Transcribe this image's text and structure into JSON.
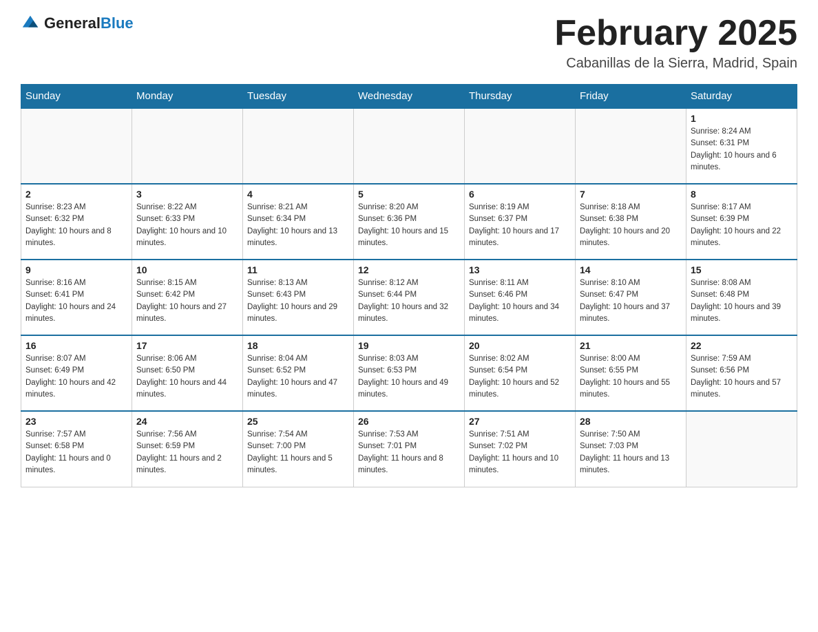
{
  "header": {
    "logo_general": "General",
    "logo_blue": "Blue",
    "month_title": "February 2025",
    "location": "Cabanillas de la Sierra, Madrid, Spain"
  },
  "days_of_week": [
    "Sunday",
    "Monday",
    "Tuesday",
    "Wednesday",
    "Thursday",
    "Friday",
    "Saturday"
  ],
  "weeks": [
    [
      {
        "day": "",
        "info": ""
      },
      {
        "day": "",
        "info": ""
      },
      {
        "day": "",
        "info": ""
      },
      {
        "day": "",
        "info": ""
      },
      {
        "day": "",
        "info": ""
      },
      {
        "day": "",
        "info": ""
      },
      {
        "day": "1",
        "info": "Sunrise: 8:24 AM\nSunset: 6:31 PM\nDaylight: 10 hours and 6 minutes."
      }
    ],
    [
      {
        "day": "2",
        "info": "Sunrise: 8:23 AM\nSunset: 6:32 PM\nDaylight: 10 hours and 8 minutes."
      },
      {
        "day": "3",
        "info": "Sunrise: 8:22 AM\nSunset: 6:33 PM\nDaylight: 10 hours and 10 minutes."
      },
      {
        "day": "4",
        "info": "Sunrise: 8:21 AM\nSunset: 6:34 PM\nDaylight: 10 hours and 13 minutes."
      },
      {
        "day": "5",
        "info": "Sunrise: 8:20 AM\nSunset: 6:36 PM\nDaylight: 10 hours and 15 minutes."
      },
      {
        "day": "6",
        "info": "Sunrise: 8:19 AM\nSunset: 6:37 PM\nDaylight: 10 hours and 17 minutes."
      },
      {
        "day": "7",
        "info": "Sunrise: 8:18 AM\nSunset: 6:38 PM\nDaylight: 10 hours and 20 minutes."
      },
      {
        "day": "8",
        "info": "Sunrise: 8:17 AM\nSunset: 6:39 PM\nDaylight: 10 hours and 22 minutes."
      }
    ],
    [
      {
        "day": "9",
        "info": "Sunrise: 8:16 AM\nSunset: 6:41 PM\nDaylight: 10 hours and 24 minutes."
      },
      {
        "day": "10",
        "info": "Sunrise: 8:15 AM\nSunset: 6:42 PM\nDaylight: 10 hours and 27 minutes."
      },
      {
        "day": "11",
        "info": "Sunrise: 8:13 AM\nSunset: 6:43 PM\nDaylight: 10 hours and 29 minutes."
      },
      {
        "day": "12",
        "info": "Sunrise: 8:12 AM\nSunset: 6:44 PM\nDaylight: 10 hours and 32 minutes."
      },
      {
        "day": "13",
        "info": "Sunrise: 8:11 AM\nSunset: 6:46 PM\nDaylight: 10 hours and 34 minutes."
      },
      {
        "day": "14",
        "info": "Sunrise: 8:10 AM\nSunset: 6:47 PM\nDaylight: 10 hours and 37 minutes."
      },
      {
        "day": "15",
        "info": "Sunrise: 8:08 AM\nSunset: 6:48 PM\nDaylight: 10 hours and 39 minutes."
      }
    ],
    [
      {
        "day": "16",
        "info": "Sunrise: 8:07 AM\nSunset: 6:49 PM\nDaylight: 10 hours and 42 minutes."
      },
      {
        "day": "17",
        "info": "Sunrise: 8:06 AM\nSunset: 6:50 PM\nDaylight: 10 hours and 44 minutes."
      },
      {
        "day": "18",
        "info": "Sunrise: 8:04 AM\nSunset: 6:52 PM\nDaylight: 10 hours and 47 minutes."
      },
      {
        "day": "19",
        "info": "Sunrise: 8:03 AM\nSunset: 6:53 PM\nDaylight: 10 hours and 49 minutes."
      },
      {
        "day": "20",
        "info": "Sunrise: 8:02 AM\nSunset: 6:54 PM\nDaylight: 10 hours and 52 minutes."
      },
      {
        "day": "21",
        "info": "Sunrise: 8:00 AM\nSunset: 6:55 PM\nDaylight: 10 hours and 55 minutes."
      },
      {
        "day": "22",
        "info": "Sunrise: 7:59 AM\nSunset: 6:56 PM\nDaylight: 10 hours and 57 minutes."
      }
    ],
    [
      {
        "day": "23",
        "info": "Sunrise: 7:57 AM\nSunset: 6:58 PM\nDaylight: 11 hours and 0 minutes."
      },
      {
        "day": "24",
        "info": "Sunrise: 7:56 AM\nSunset: 6:59 PM\nDaylight: 11 hours and 2 minutes."
      },
      {
        "day": "25",
        "info": "Sunrise: 7:54 AM\nSunset: 7:00 PM\nDaylight: 11 hours and 5 minutes."
      },
      {
        "day": "26",
        "info": "Sunrise: 7:53 AM\nSunset: 7:01 PM\nDaylight: 11 hours and 8 minutes."
      },
      {
        "day": "27",
        "info": "Sunrise: 7:51 AM\nSunset: 7:02 PM\nDaylight: 11 hours and 10 minutes."
      },
      {
        "day": "28",
        "info": "Sunrise: 7:50 AM\nSunset: 7:03 PM\nDaylight: 11 hours and 13 minutes."
      },
      {
        "day": "",
        "info": ""
      }
    ]
  ]
}
